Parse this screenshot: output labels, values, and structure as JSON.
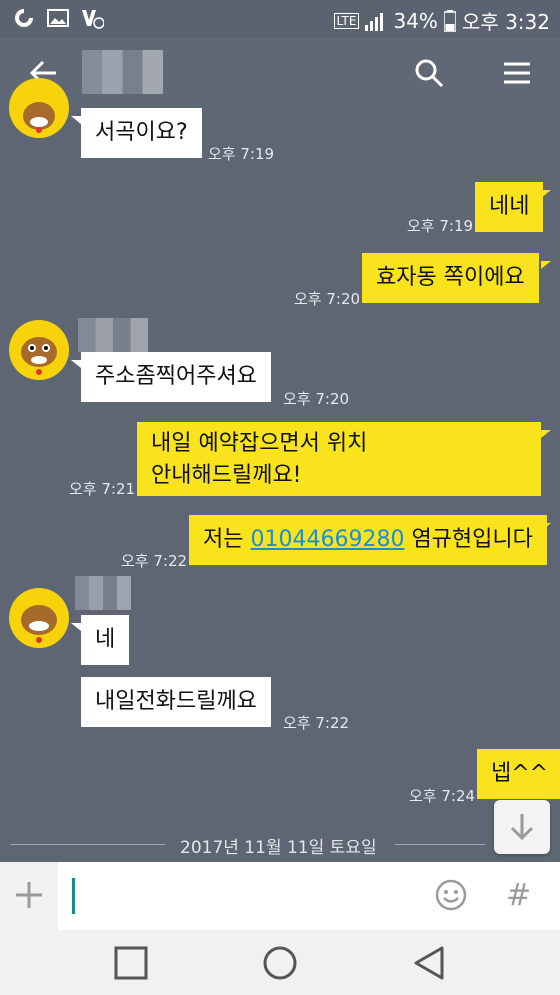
{
  "status_bar": {
    "network": "LTE",
    "battery": "34%",
    "time": "오후 3:32"
  },
  "app_bar": {
    "back_icon": "arrow-left-icon",
    "search_icon": "search-icon",
    "menu_icon": "hamburger-menu-icon"
  },
  "messages": [
    {
      "side": "left",
      "text": "서곡이요?",
      "time": "오후 7:19"
    },
    {
      "side": "right",
      "text": "네네",
      "time": "오후 7:19"
    },
    {
      "side": "right",
      "text": "효자동 쪽이에요",
      "time": "오후 7:20"
    },
    {
      "side": "left",
      "text": "주소좀찍어주셔요",
      "time": "오후 7:20"
    },
    {
      "side": "right",
      "text_line1": "내일 예약잡으면서 위치",
      "text_line2": "안내해드릴께요!",
      "time": "오후 7:21"
    },
    {
      "side": "right",
      "text_before": "저는 ",
      "link": "01044669280",
      "text_after": " 염규현입니다",
      "time": "오후 7:22"
    },
    {
      "side": "left",
      "text": "네"
    },
    {
      "side": "left",
      "text": "내일전화드릴께요",
      "time": "오후 7:22"
    },
    {
      "side": "right",
      "text": "넵^^",
      "time": "오후 7:24"
    }
  ],
  "date_divider": "2017년 11월 11일 토요일",
  "composer": {
    "placeholder": "",
    "plus_icon": "plus-icon",
    "emoji_icon": "emoji-icon",
    "hash_label": "#"
  },
  "colors": {
    "chat_bg": "#5f6673",
    "my_bubble": "#f8e31c",
    "their_bubble": "#ffffff",
    "link": "#1a8fd6"
  }
}
